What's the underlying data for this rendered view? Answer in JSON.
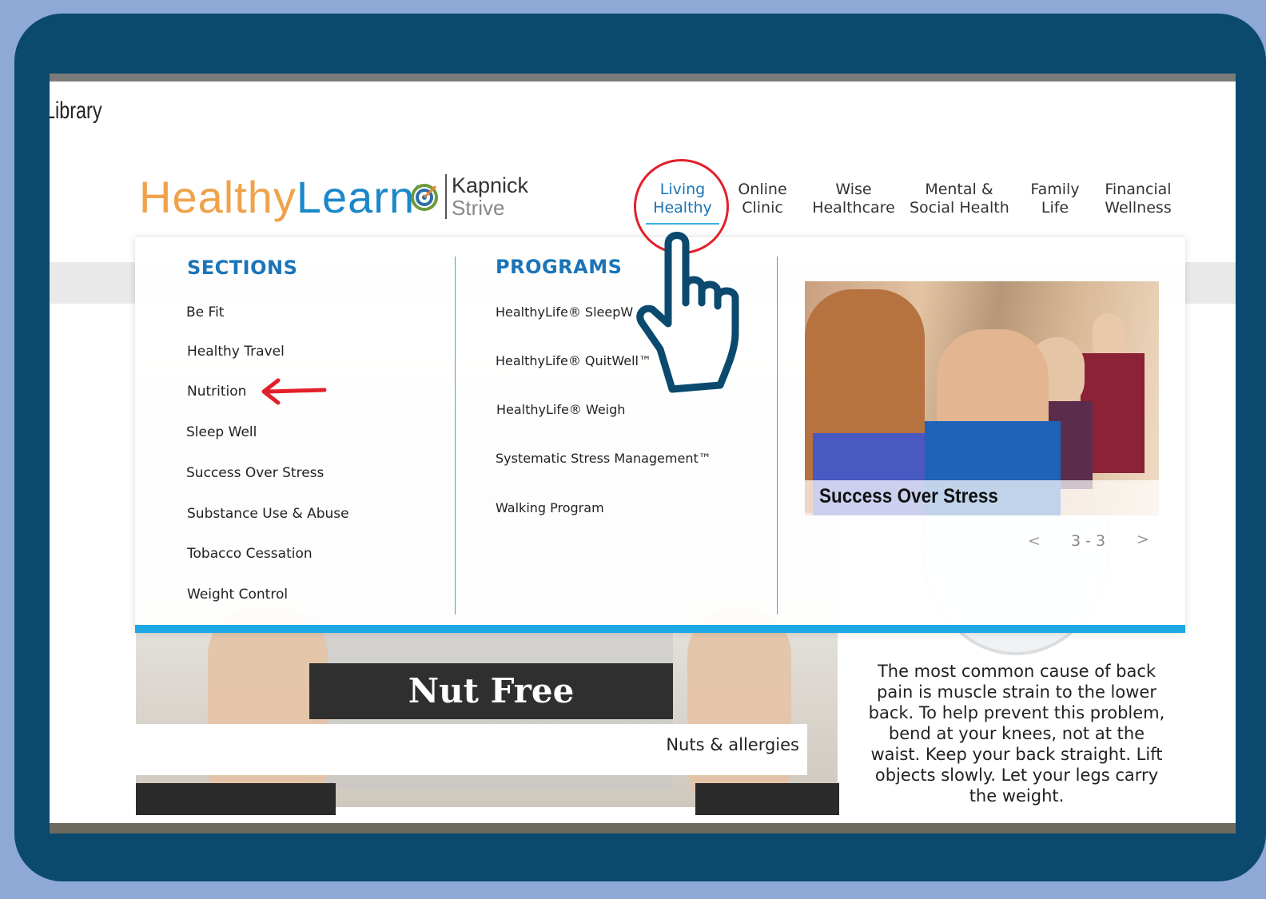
{
  "background_page": {
    "section_title": "Library",
    "caption": "Nuts & allergies",
    "card_text": "Nut Free",
    "side_text": "The most common cause of back pain is muscle strain to the lower back. To help prevent this problem, bend at your knees, not at the waist. Keep your back straight. Lift objects slowly. Let your legs carry the weight."
  },
  "brand": {
    "healthy": "Healthy",
    "learn": "Learn",
    "reg": "®",
    "partner_line1": "Kapnick",
    "partner_line2": "Strive"
  },
  "nav": [
    {
      "line1": "Living",
      "line2": "Healthy",
      "active": true
    },
    {
      "line1": "Online",
      "line2": "Clinic"
    },
    {
      "line1": "Wise",
      "line2": "Healthcare"
    },
    {
      "line1": "Mental &",
      "line2": "Social Health"
    },
    {
      "line1": "Family",
      "line2": "Life"
    },
    {
      "line1": "Financial",
      "line2": "Wellness"
    }
  ],
  "dropdown": {
    "sections_heading": "SECTIONS",
    "sections": [
      "Be Fit",
      "Healthy Travel",
      "Nutrition",
      "Sleep Well",
      "Success Over Stress",
      "Substance Use & Abuse",
      "Tobacco Cessation",
      "Weight Control"
    ],
    "programs_heading": "PROGRAMS",
    "programs": [
      "HealthyLife® SleepW",
      "HealthyLife® QuitWell™",
      "HealthyLife® Weigh",
      "Systematic Stress Management™",
      "Walking Program"
    ],
    "promo": {
      "caption": "Success Over Stress",
      "pager_prev": "<",
      "pager_text": "3 - 3",
      "pager_next": ">"
    }
  },
  "colors": {
    "frame": "#0b4a6e",
    "outer": "#8ea9d6",
    "accent_blue": "#1a74b8",
    "accent_bar": "#1da7e4",
    "highlight_red": "#e2202a",
    "brand_orange": "#f0a24a"
  },
  "icons": {
    "pointer": "pointing-hand-icon",
    "arrow": "red-arrow-icon",
    "target": "target-logo-icon"
  }
}
